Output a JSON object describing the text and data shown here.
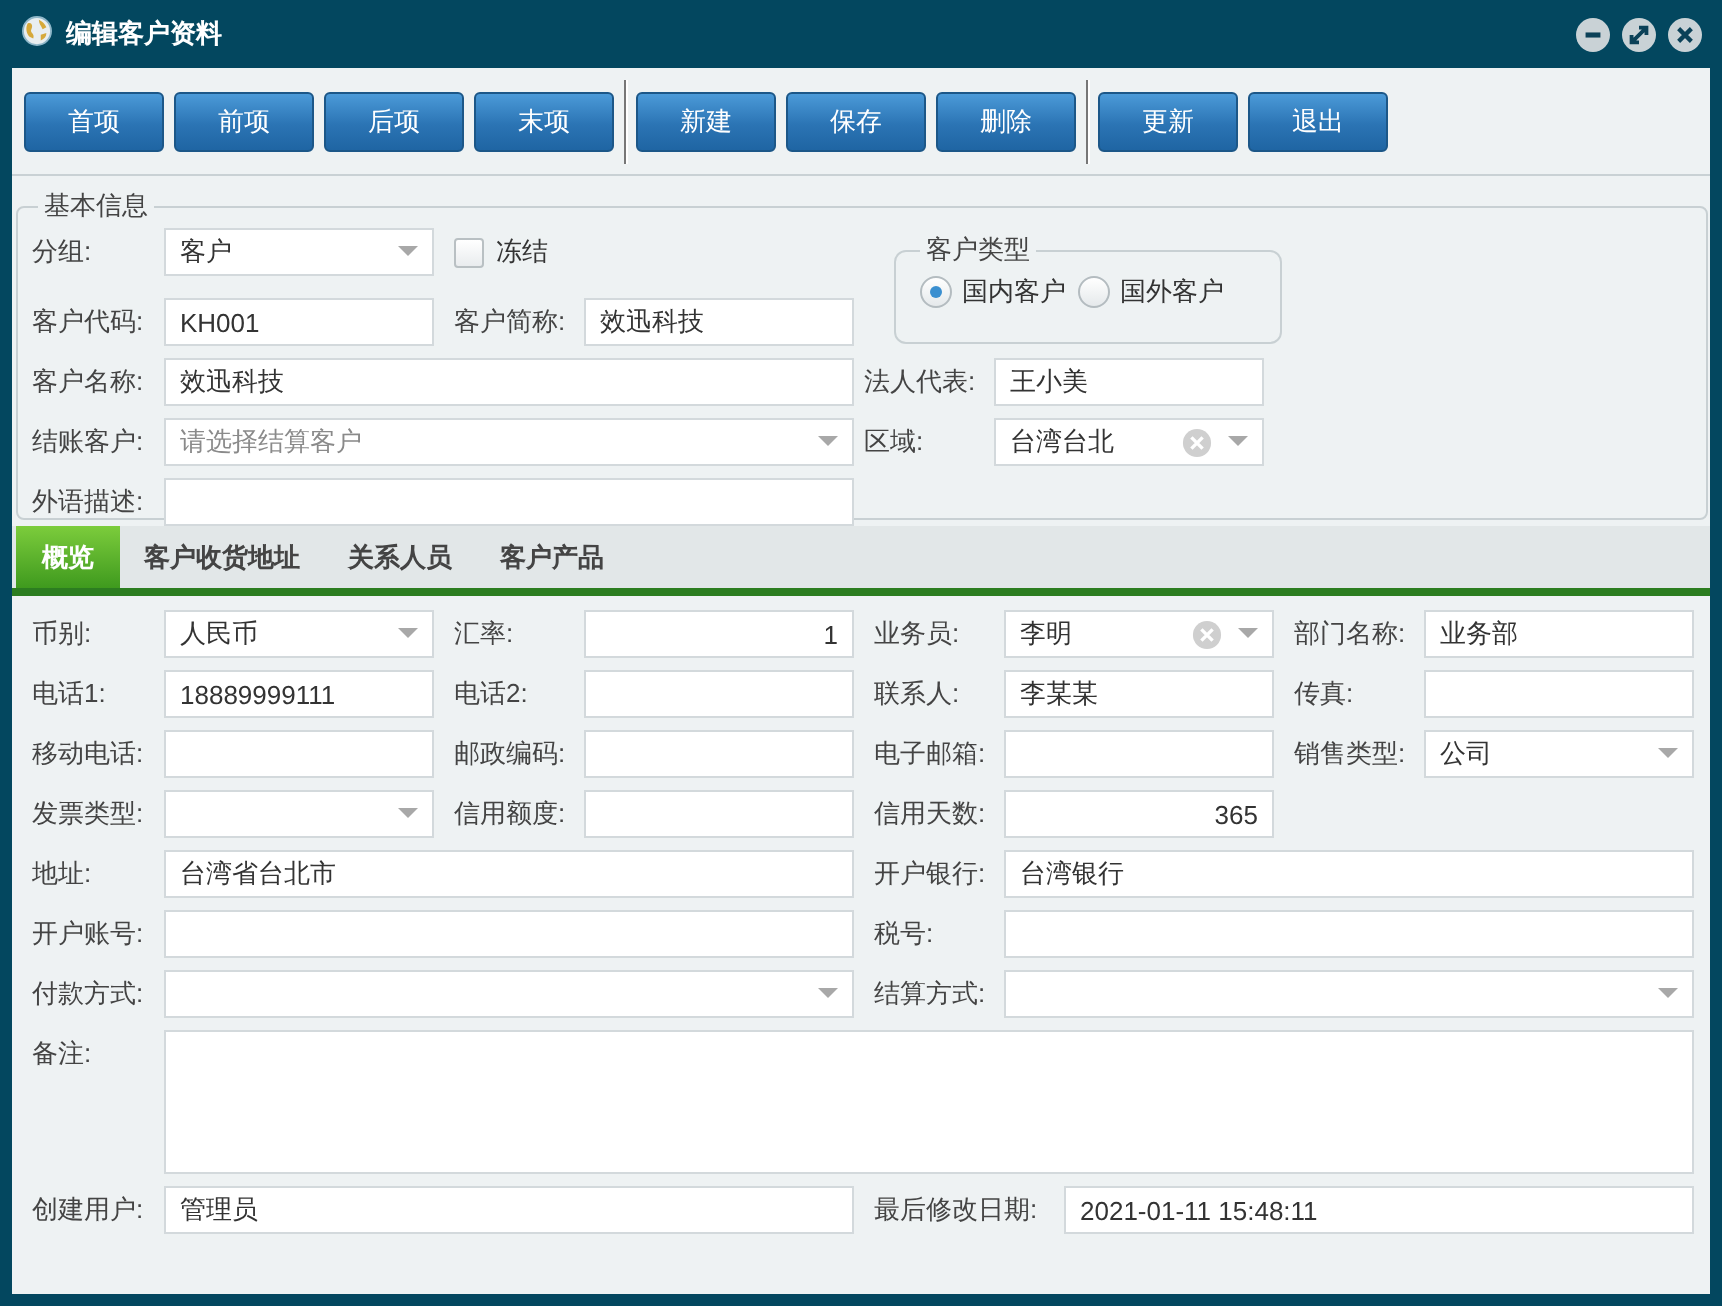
{
  "window": {
    "title": "编辑客户资料"
  },
  "toolbar": {
    "groups": [
      [
        "首项",
        "前项",
        "后项",
        "末项"
      ],
      [
        "新建",
        "保存",
        "删除"
      ],
      [
        "更新",
        "退出"
      ]
    ]
  },
  "basic_info": {
    "legend": "基本信息",
    "rows": [
      [
        {
          "kind": "combo",
          "label": "分组:",
          "value": "客户"
        },
        {
          "kind": "checkbox",
          "label": "冻结",
          "checked": false
        }
      ],
      [
        {
          "kind": "text",
          "label": "客户代码:",
          "value": "KH001"
        },
        {
          "kind": "text",
          "label": "客户简称:",
          "value": "效迅科技"
        }
      ],
      [
        {
          "kind": "text",
          "label": "客户名称:",
          "value": "效迅科技"
        },
        {
          "kind": "text",
          "label": "法人代表:",
          "value": "王小美"
        }
      ],
      [
        {
          "kind": "combo",
          "label": "结账客户:",
          "placeholder": "请选择结算客户"
        },
        {
          "kind": "combo_clear",
          "label": "区域:",
          "value": "台湾台北"
        }
      ],
      [
        {
          "kind": "text",
          "label": "外语描述:"
        }
      ]
    ],
    "customer_type": {
      "legend": "客户类型",
      "options": [
        {
          "label": "国内客户",
          "selected": true
        },
        {
          "label": "国外客户",
          "selected": false
        }
      ]
    }
  },
  "tabs": [
    {
      "label": "概览",
      "selected": true
    },
    {
      "label": "客户收货地址",
      "selected": false
    },
    {
      "label": "关系人员",
      "selected": false
    },
    {
      "label": "客户产品",
      "selected": false
    }
  ],
  "overview": {
    "rows": [
      [
        {
          "kind": "combo",
          "label": "币别:",
          "value": "人民币"
        },
        {
          "kind": "number",
          "label": "汇率:",
          "value": "1"
        },
        {
          "kind": "combo_clear",
          "label": "业务员:",
          "value": "李明"
        },
        {
          "kind": "text",
          "label": "部门名称:",
          "value": "业务部"
        }
      ],
      [
        {
          "kind": "text",
          "label": "电话1:",
          "value": "18889999111"
        },
        {
          "kind": "text",
          "label": "电话2:"
        },
        {
          "kind": "text",
          "label": "联系人:",
          "value": "李某某"
        },
        {
          "kind": "text",
          "label": "传真:"
        }
      ],
      [
        {
          "kind": "text",
          "label": "移动电话:"
        },
        {
          "kind": "text",
          "label": "邮政编码:"
        },
        {
          "kind": "text",
          "label": "电子邮箱:"
        },
        {
          "kind": "combo",
          "label": "销售类型:",
          "value": "公司"
        }
      ],
      [
        {
          "kind": "combo",
          "label": "发票类型:"
        },
        {
          "kind": "text",
          "label": "信用额度:"
        },
        {
          "kind": "number",
          "label": "信用天数:",
          "value": "365"
        }
      ],
      [
        {
          "kind": "text",
          "label": "地址:",
          "value": "台湾省台北市"
        },
        {
          "kind": "text",
          "label": "开户银行:",
          "value": "台湾银行"
        }
      ],
      [
        {
          "kind": "text",
          "label": "开户账号:"
        },
        {
          "kind": "text",
          "label": "税号:"
        }
      ],
      [
        {
          "kind": "combo",
          "label": "付款方式:"
        },
        {
          "kind": "combo",
          "label": "结算方式:"
        }
      ],
      [
        {
          "kind": "textarea",
          "label": "备注:"
        }
      ],
      [
        {
          "kind": "text",
          "label": "创建用户:",
          "value": "管理员"
        },
        {
          "kind": "datetime",
          "label": "最后修改日期:",
          "value": "2021-01-11 15:48:11"
        }
      ]
    ]
  }
}
